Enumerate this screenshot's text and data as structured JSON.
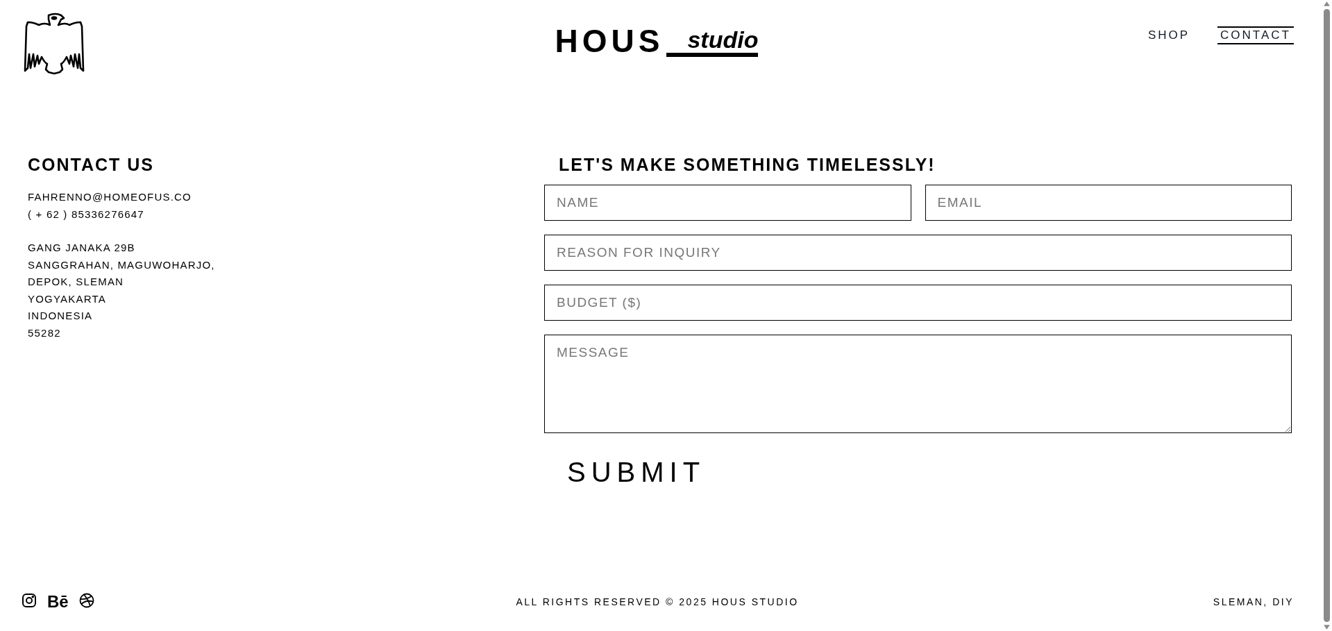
{
  "header": {
    "logo": {
      "word": "HOUS",
      "script": "studio"
    },
    "nav": [
      {
        "label": "SHOP",
        "selected": false
      },
      {
        "label": "CONTACT",
        "selected": true
      }
    ]
  },
  "contact": {
    "title": "CONTACT US",
    "email": "FAHRENNO@HOMEOFUS.CO",
    "phone": "( + 62 ) 85336276647",
    "address": [
      "GANG JANAKA 29B",
      "SANGGRAHAN, MAGUWOHARJO,",
      "DEPOK, SLEMAN",
      "YOGYAKARTA",
      "INDONESIA",
      "55282"
    ]
  },
  "form": {
    "title": "LET'S MAKE SOMETHING TIMELESSLY!",
    "fields": [
      {
        "kind": "half",
        "placeholder": "NAME"
      },
      {
        "kind": "half",
        "placeholder": "EMAIL"
      },
      {
        "kind": "full",
        "placeholder": "REASON FOR INQUIRY"
      },
      {
        "kind": "full",
        "placeholder": "BUDGET ($)"
      },
      {
        "kind": "multiline",
        "placeholder": "MESSAGE"
      }
    ],
    "submit": "SUBMIT"
  },
  "footer": {
    "social": [
      {
        "kind": "instagram"
      },
      {
        "kind": "behance",
        "label": "Bē"
      },
      {
        "kind": "dribbble"
      }
    ],
    "copyright": "ALL RIGHTS RESERVED © 2025 HOUS STUDIO",
    "location": "SLEMAN, DIY"
  }
}
